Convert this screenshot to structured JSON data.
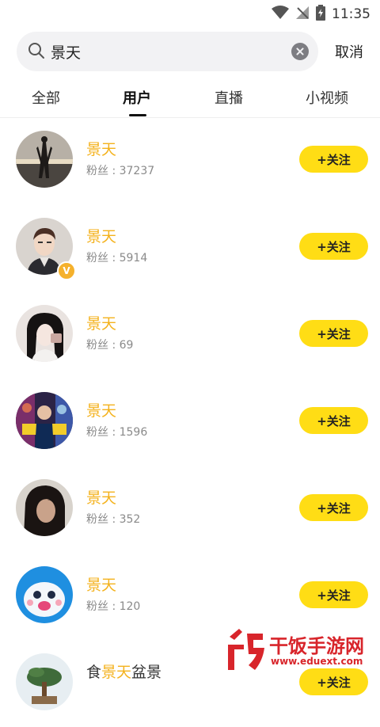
{
  "status": {
    "time": "11:35",
    "icons": [
      "wifi-icon",
      "signal-icon",
      "battery-icon"
    ]
  },
  "search": {
    "query": "景天",
    "cancel_label": "取消"
  },
  "tabs": [
    {
      "label": "全部",
      "active": false
    },
    {
      "label": "用户",
      "active": true
    },
    {
      "label": "直播",
      "active": false
    },
    {
      "label": "小视频",
      "active": false
    }
  ],
  "users": [
    {
      "name": "景天",
      "fans": "粉丝 : 37237",
      "follow_label": "+关注",
      "verified": false
    },
    {
      "name": "景天",
      "fans": "粉丝 : 5914",
      "follow_label": "+关注",
      "verified": true,
      "badge": "V"
    },
    {
      "name": "景天",
      "fans": "粉丝 : 69",
      "follow_label": "+关注",
      "verified": false
    },
    {
      "name": "景天",
      "fans": "粉丝 : 1596",
      "follow_label": "+关注",
      "verified": false
    },
    {
      "name": "景天",
      "fans": "粉丝 : 352",
      "follow_label": "+关注",
      "verified": false
    },
    {
      "name": "景天",
      "fans": "粉丝 : 120",
      "follow_label": "+关注",
      "verified": false
    }
  ],
  "partial_user": {
    "name_prefix": "食",
    "name_match": "景天",
    "name_suffix": "盆景",
    "follow_label": "+关注"
  },
  "watermark": {
    "title": "干饭手游网",
    "url": "www.eduext.com"
  },
  "colors": {
    "highlight": "#f4b21d",
    "follow_button": "#ffdd15",
    "watermark": "#d8252b"
  }
}
